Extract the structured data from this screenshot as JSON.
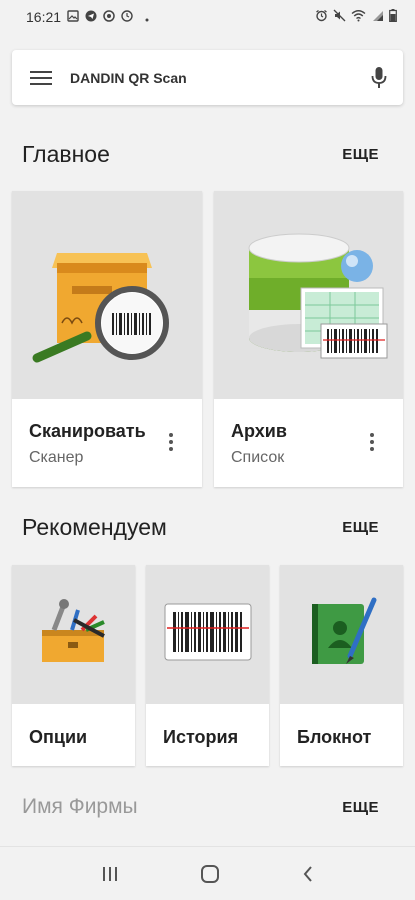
{
  "status_bar": {
    "time": "16:21",
    "left_icons": [
      "image-icon",
      "telegram-icon",
      "headset-icon",
      "clock-icon",
      "dot-icon"
    ],
    "right_icons": [
      "alarm-icon",
      "mute-icon",
      "wifi-icon",
      "signal-icon",
      "battery-icon"
    ]
  },
  "search_bar": {
    "menu_icon": "menu-icon",
    "title": "DANDIN QR Scan",
    "mic_icon": "mic-icon"
  },
  "sections": {
    "main": {
      "title": "Главное",
      "more": "ЕЩЕ",
      "cards": [
        {
          "title": "Сканировать",
          "subtitle": "Сканер",
          "icon": "box-magnifier-barcode-icon"
        },
        {
          "title": "Архив",
          "subtitle": "Список",
          "icon": "database-barcode-icon"
        }
      ]
    },
    "recommended": {
      "title": "Рекомендуем",
      "more": "ЕЩЕ",
      "cards": [
        {
          "title": "Опции",
          "icon": "toolbox-icon"
        },
        {
          "title": "История",
          "icon": "barcode-icon"
        },
        {
          "title": "Блокнот",
          "icon": "address-book-icon"
        }
      ]
    },
    "company": {
      "title": "Имя Фирмы",
      "more": "ЕЩЕ"
    }
  },
  "nav_bar": {
    "items": [
      "recents-icon",
      "home-icon",
      "back-icon"
    ]
  },
  "colors": {
    "background": "#f2f2f2",
    "card_image_bg": "#e2e2e2",
    "box_orange": "#f0a830",
    "db_green": "#8cc63f",
    "book_green": "#2e7d32"
  }
}
